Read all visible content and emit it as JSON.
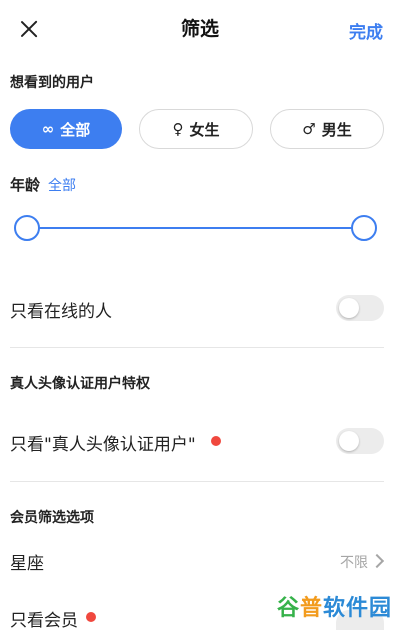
{
  "header": {
    "title": "筛选",
    "done_label": "完成"
  },
  "audience": {
    "heading": "想看到的用户",
    "options": [
      {
        "icon": "∞",
        "label": "全部",
        "selected": true
      },
      {
        "icon": "♀",
        "label": "女生",
        "selected": false
      },
      {
        "icon": "♂",
        "label": "男生",
        "selected": false
      }
    ]
  },
  "age": {
    "label": "年龄",
    "value": "全部"
  },
  "online": {
    "label": "只看在线的人",
    "enabled": false
  },
  "verified": {
    "heading": "真人头像认证用户特权",
    "label": "只看\"真人头像认证用户\"",
    "enabled": false
  },
  "member": {
    "heading": "会员筛选选项",
    "zodiac_label": "星座",
    "zodiac_value": "不限",
    "members_only_label": "只看会员"
  },
  "watermark": {
    "part1": "谷",
    "part2": "普",
    "part3": "软件园"
  },
  "colors": {
    "accent": "#3d7ef0",
    "dot": "#f0483e"
  }
}
